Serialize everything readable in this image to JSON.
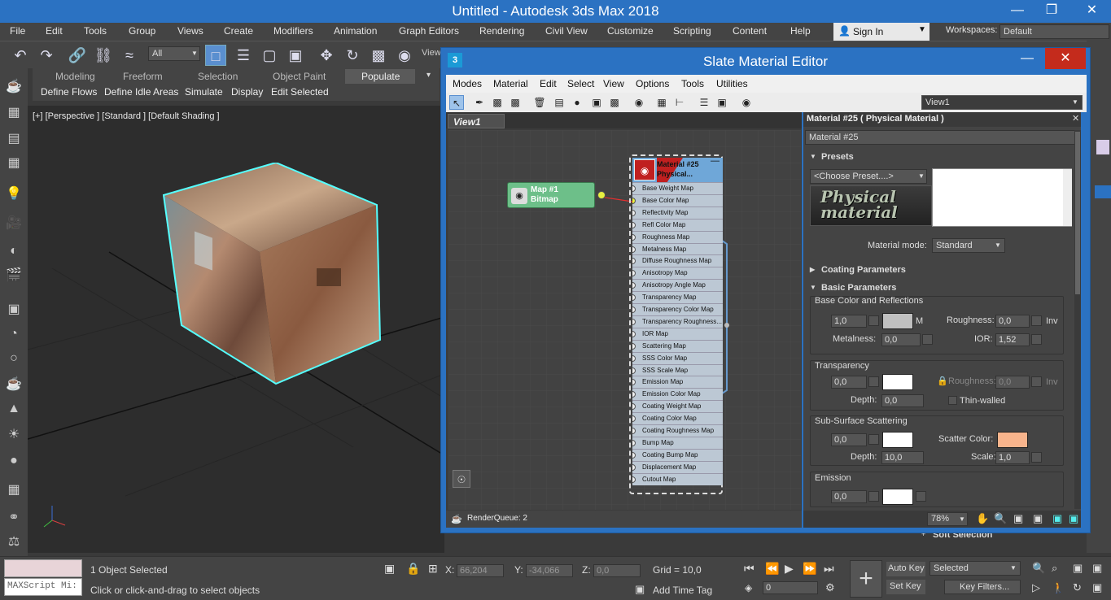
{
  "app": {
    "title": "Untitled - Autodesk 3ds Max 2018",
    "sign_in": "Sign In",
    "workspaces_label": "Workspaces:",
    "workspace": "Default"
  },
  "menu": [
    "File",
    "Edit",
    "Tools",
    "Group",
    "Views",
    "Create",
    "Modifiers",
    "Animation",
    "Graph Editors",
    "Rendering",
    "Civil View",
    "Customize",
    "Scripting",
    "Content",
    "Help"
  ],
  "toolbar": {
    "filter": "All",
    "view_label": "View"
  },
  "ribbon": {
    "tabs": [
      "Modeling",
      "Freeform",
      "Selection",
      "Object Paint",
      "Populate"
    ],
    "buttons": [
      "Define Flows",
      "Define Idle Areas",
      "Simulate",
      "Display",
      "Edit Selected"
    ]
  },
  "viewport": {
    "label": "[+] [Perspective ] [Standard ] [Default Shading ]"
  },
  "slate": {
    "title": "Slate Material Editor",
    "menu": [
      "Modes",
      "Material",
      "Edit",
      "Select",
      "View",
      "Options",
      "Tools",
      "Utilities"
    ],
    "view_select": "View1",
    "view_tab": "View1",
    "bitmap_node": {
      "line1": "Map #1",
      "line2": "Bitmap"
    },
    "material_node": {
      "line1": "Material #25",
      "line2": "Physical...",
      "slots": [
        "Base Weight Map",
        "Base Color Map",
        "Reflectivity Map",
        "Refl Color Map",
        "Roughness Map",
        "Metalness Map",
        "Diffuse Roughness Map",
        "Anisotropy Map",
        "Anisotropy Angle Map",
        "Transparency Map",
        "Transparency Color Map",
        "Transparency Roughness...",
        "IOR Map",
        "Scattering Map",
        "SSS Color Map",
        "SSS Scale Map",
        "Emission Map",
        "Emission Color Map",
        "Coating Weight Map",
        "Coating Color Map",
        "Coating Roughness Map",
        "Bump Map",
        "Coating Bump Map",
        "Displacement Map",
        "Cutout Map"
      ]
    },
    "status": "RenderQueue: 2",
    "zoom": "78%",
    "props": {
      "header": "Material #25  ( Physical Material )",
      "name": "Material #25",
      "presets": "Presets",
      "choose_preset": "<Choose Preset....>",
      "logo_text": "Physical material",
      "material_mode_label": "Material mode:",
      "material_mode": "Standard",
      "coating": "Coating Parameters",
      "basic": "Basic Parameters",
      "base_color_group": "Base Color and Reflections",
      "base_weight": "1,0",
      "m_label": "M",
      "roughness_label": "Roughness:",
      "roughness": "0,0",
      "inv": "Inv",
      "metalness_label": "Metalness:",
      "metalness": "0,0",
      "ior_label": "IOR:",
      "ior": "1,52",
      "transparency_group": "Transparency",
      "transparency": "0,0",
      "t_roughness_label": "Roughness:",
      "t_roughness": "0,0",
      "t_inv": "Inv",
      "depth_label": "Depth:",
      "depth": "0,0",
      "thin_walled": "Thin-walled",
      "sss_group": "Sub-Surface Scattering",
      "sss": "0,0",
      "scatter_color_label": "Scatter Color:",
      "sss_depth_label": "Depth:",
      "sss_depth": "10,0",
      "scale_label": "Scale:",
      "scale": "1,0",
      "emission_group": "Emission",
      "emission": "0,0"
    },
    "colors": {
      "base": "#c0c0c0",
      "transparency": "#ffffff",
      "sss": "#ffffff",
      "scatter": "#f8b48c",
      "emission": "#ffffff"
    }
  },
  "cmdpanel": {
    "soft_selection": "Soft Selection"
  },
  "status": {
    "maxscript": "MAXScript Mi:",
    "selected": "1 Object Selected",
    "hint": "Click or click-and-drag to select objects",
    "x_label": "X:",
    "x": "66,204",
    "y_label": "Y:",
    "y": "-34,066",
    "z_label": "Z:",
    "z": "0,0",
    "grid": "Grid = 10,0",
    "add_time_tag": "Add Time Tag",
    "frame": "0",
    "auto_key": "Auto Key",
    "set_key": "Set Key",
    "selected_dd": "Selected",
    "key_filters": "Key Filters..."
  }
}
